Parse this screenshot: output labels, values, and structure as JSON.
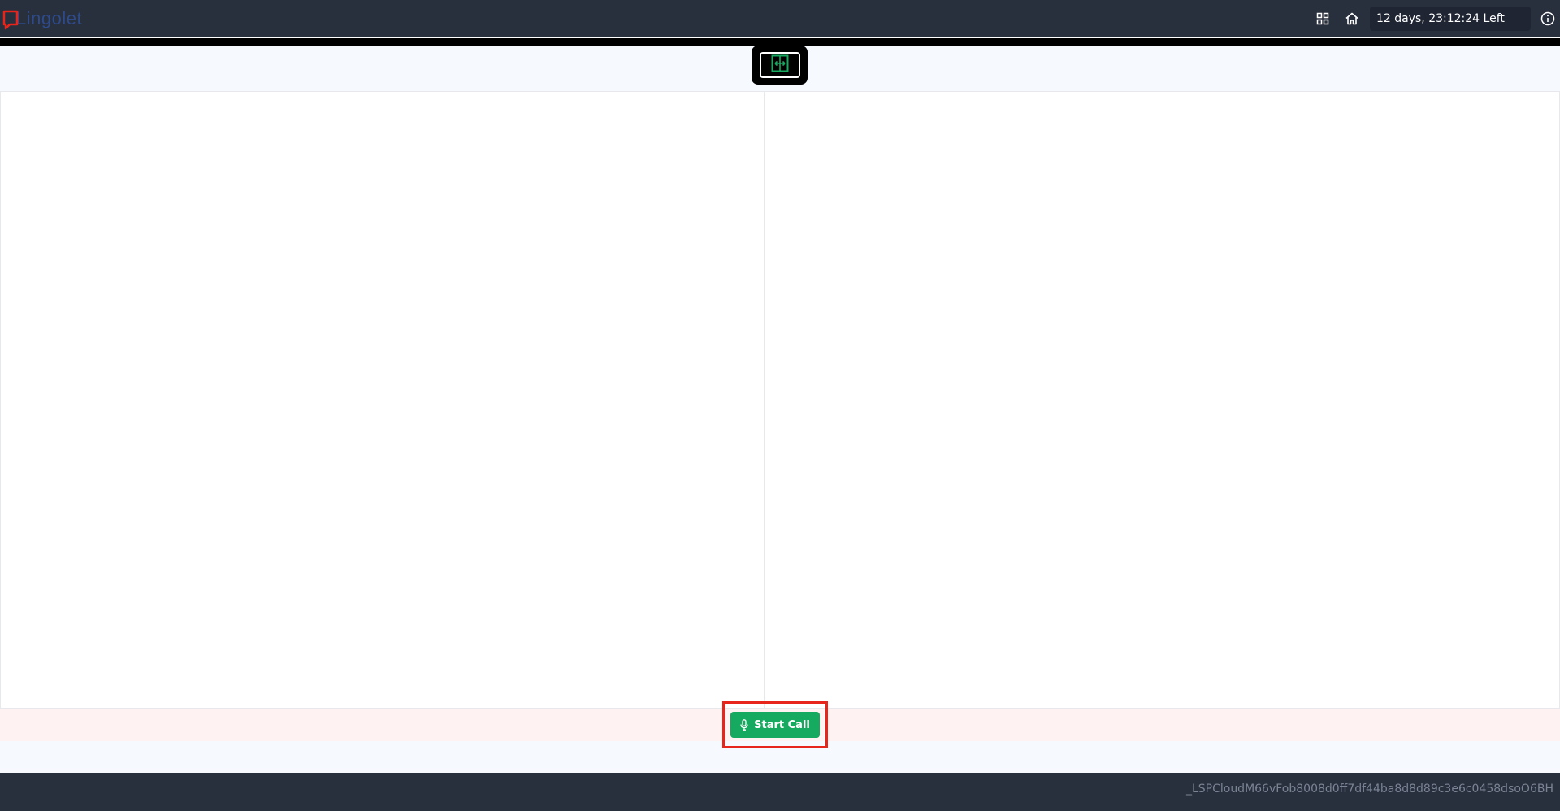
{
  "header": {
    "logo_text": "Lingolet",
    "timer_text": "12 days, 23:12:24 Left",
    "icons": [
      "grid-icon",
      "home-icon",
      "info-icon"
    ]
  },
  "toolbar": {
    "swap_icon": "swap-panels-icon"
  },
  "call": {
    "start_label": "Start Call",
    "button_color": "#16a960",
    "highlight_color": "#e8251a"
  },
  "footer": {
    "session_id": "_LSPCloudM66vFob8008d0ff7df44ba8d8d89c3e6c0458dsoO6BH"
  },
  "colors": {
    "topbar": "#282f3d",
    "accent_red": "#e8251a",
    "accent_green": "#16a960"
  }
}
